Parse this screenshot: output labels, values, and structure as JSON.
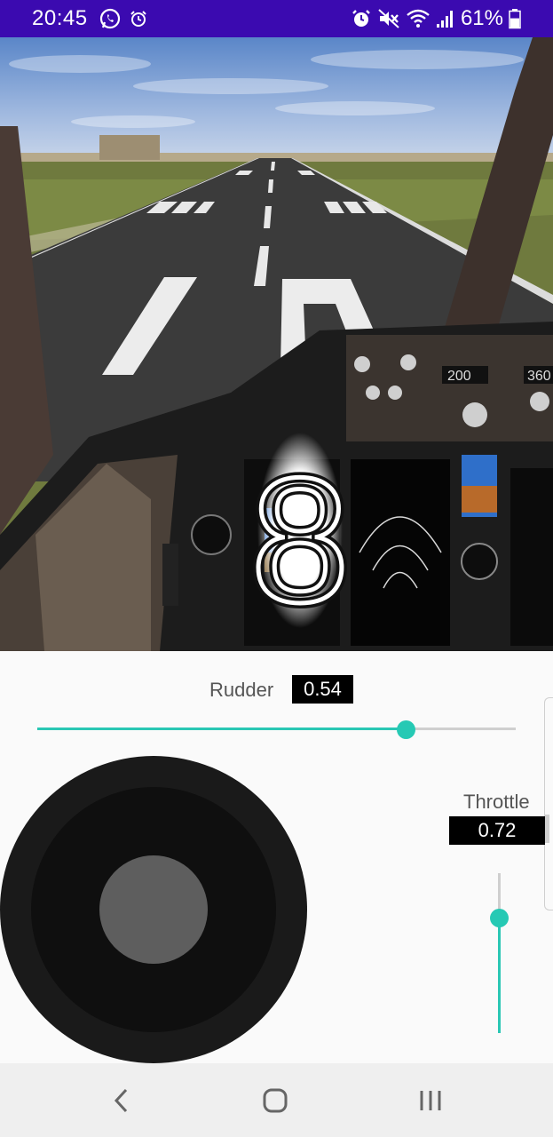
{
  "status_bar": {
    "time": "20:45",
    "left_icons": [
      "whatsapp-icon",
      "alarm-icon"
    ],
    "right_icons": [
      "alarm-icon",
      "mute-icon",
      "wifi-icon",
      "signal-icon"
    ],
    "battery_text": "61%",
    "battery_level": 0.61
  },
  "flight_view": {
    "runway_number": "10",
    "overlay_digit": "8",
    "instruments": {
      "speed": "200",
      "heading": "360"
    }
  },
  "controls": {
    "rudder": {
      "label": "Rudder",
      "value_text": "0.54",
      "value": 0.77
    },
    "throttle": {
      "label": "Throttle",
      "value_text": "0.72",
      "value": 0.72
    }
  },
  "colors": {
    "status_bar": "#3b0ab0",
    "accent": "#26c9b4",
    "value_box": "#000000"
  },
  "nav_bar": {
    "buttons": [
      "back-icon",
      "home-icon",
      "recents-icon"
    ]
  }
}
